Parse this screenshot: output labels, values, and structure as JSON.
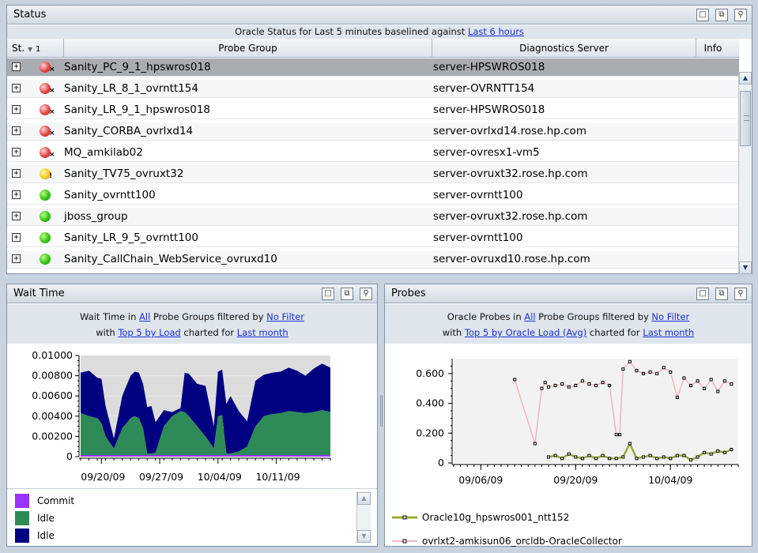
{
  "status_panel": {
    "title": "Status",
    "subtitle_prefix": "Oracle Status for Last 5 minutes baselined against ",
    "subtitle_link": "Last 6 hours",
    "columns": {
      "status": "St.",
      "sort_order": "1",
      "probe_group": "Probe Group",
      "server": "Diagnostics Server",
      "info": "Info"
    },
    "rows": [
      {
        "status": "red",
        "mark": "×",
        "probe_group": "Sanity_PC_9_1_hpswros018",
        "server": "server-HPSWROS018"
      },
      {
        "status": "red",
        "mark": "×",
        "probe_group": "Sanity_LR_8_1_ovrntt154",
        "server": "server-OVRNTT154"
      },
      {
        "status": "red",
        "mark": "×",
        "probe_group": "Sanity_LR_9_1_hpswros018",
        "server": "server-HPSWROS018"
      },
      {
        "status": "red",
        "mark": "×",
        "probe_group": "Sanity_CORBA_ovrlxd14",
        "server": "server-ovrlxd14.rose.hp.com"
      },
      {
        "status": "red",
        "mark": "×",
        "probe_group": "MQ_amkilab02",
        "server": "server-ovresx1-vm5"
      },
      {
        "status": "yellow",
        "mark": "!",
        "probe_group": "Sanity_TV75_ovruxt32",
        "server": "server-ovruxt32.rose.hp.com"
      },
      {
        "status": "green",
        "mark": "",
        "probe_group": "Sanity_ovrntt100",
        "server": "server-ovrntt100"
      },
      {
        "status": "green",
        "mark": "",
        "probe_group": "jboss_group",
        "server": "server-ovruxt32.rose.hp.com"
      },
      {
        "status": "green",
        "mark": "",
        "probe_group": "Sanity_LR_9_5_ovrntt100",
        "server": "server-ovrntt100"
      },
      {
        "status": "green",
        "mark": "",
        "probe_group": "Sanity_CallChain_WebService_ovruxd10",
        "server": "server-ovruxd10.rose.hp.com"
      }
    ]
  },
  "wait_panel": {
    "title": "Wait Time",
    "line1_prefix": "Wait Time in ",
    "line1_link1": "All",
    "line1_mid": " Probe Groups filtered by ",
    "line1_link2": "No Filter",
    "line2_prefix": "with ",
    "line2_link1": "Top 5 by Load",
    "line2_mid": " charted for ",
    "line2_link2": "Last month",
    "legend": [
      {
        "label": "Commit",
        "color": "#9a33ff"
      },
      {
        "label": "Idle",
        "color": "#2e8b57"
      },
      {
        "label": "Idle",
        "color": "#000080"
      }
    ]
  },
  "probes_panel": {
    "title": "Probes",
    "line1_prefix": "Oracle Probes in ",
    "line1_link1": "All",
    "line1_mid": " Probe Groups filtered by ",
    "line1_link2": "No Filter",
    "line2_prefix": "with ",
    "line2_link1": "Top 5 by Oracle Load (Avg)",
    "line2_mid": " charted for ",
    "line2_link2": "Last month"
  },
  "window_buttons": {
    "restore": "□",
    "popout": "⧉",
    "pin": "⚲"
  },
  "chart_data": [
    {
      "type": "area",
      "stacked": true,
      "x_tick_labels": [
        "09/20/09",
        "09/27/09",
        "10/04/09",
        "10/11/09"
      ],
      "y_ticks": [
        "0.01000",
        "0.00800",
        "0.00600",
        "0.00400",
        "0.00200",
        "0"
      ],
      "ylim": [
        0,
        0.01
      ],
      "x_range_days": [
        0,
        30
      ],
      "series": [
        {
          "name": "Commit",
          "color": "#9a33ff",
          "x": [
            0,
            30
          ],
          "values": [
            0.0,
            0.0
          ]
        },
        {
          "name": "Idle",
          "color": "#2e8b57",
          "x": [
            0,
            1,
            2,
            2.5,
            3,
            4,
            5,
            6,
            6.5,
            7,
            7.5,
            8,
            8.5,
            9,
            10,
            11,
            12,
            12.5,
            13,
            14,
            15,
            16,
            16.5,
            17,
            17.5,
            18,
            19,
            20,
            21,
            22,
            23,
            24,
            25,
            26,
            27,
            28,
            29,
            30
          ],
          "values": [
            0.0043,
            0.004,
            0.0038,
            0.0033,
            0.002,
            0.0008,
            0.0028,
            0.0038,
            0.004,
            0.0038,
            0.0028,
            0.0003,
            0.0003,
            0.0004,
            0.003,
            0.004,
            0.0045,
            0.0044,
            0.004,
            0.003,
            0.002,
            0.0008,
            0.004,
            0.0041,
            0.0003,
            0.0003,
            0.0005,
            0.001,
            0.003,
            0.004,
            0.0042,
            0.0043,
            0.0045,
            0.0044,
            0.0043,
            0.0044,
            0.0046,
            0.0044
          ]
        },
        {
          "name": "Idle",
          "color": "#000080",
          "x": [
            0,
            1,
            2,
            2.5,
            3,
            4,
            5,
            6,
            6.5,
            7,
            7.5,
            8,
            8.5,
            9,
            10,
            11,
            12,
            12.5,
            13,
            14,
            15,
            16,
            16.5,
            17,
            17.5,
            18,
            19,
            20,
            21,
            22,
            23,
            24,
            25,
            26,
            27,
            28,
            29,
            30
          ],
          "values": [
            0.004,
            0.0045,
            0.004,
            0.0044,
            0.003,
            0.001,
            0.0032,
            0.0042,
            0.0044,
            0.0045,
            0.0044,
            0.0046,
            0.0047,
            0.003,
            0.0016,
            0.0004,
            0.0003,
            0.0039,
            0.0042,
            0.0042,
            0.005,
            0.0022,
            0.0044,
            0.0045,
            0.0049,
            0.0057,
            0.004,
            0.0025,
            0.0045,
            0.0041,
            0.0041,
            0.0041,
            0.0043,
            0.0041,
            0.0037,
            0.0043,
            0.0046,
            0.0044
          ]
        }
      ]
    },
    {
      "type": "line",
      "x_tick_labels": [
        "09/06/09",
        "09/20/09",
        "10/04/09"
      ],
      "y_ticks": [
        "0.600",
        "0.400",
        "0.200",
        "0"
      ],
      "ylim": [
        0,
        0.7
      ],
      "x_range_days": [
        0,
        42
      ],
      "series": [
        {
          "name": "Oracle10g_hpswros001_ntt152",
          "color": "#9aa830",
          "marker_color": "#000000",
          "x": [
            14,
            15,
            16,
            17,
            18,
            19,
            20,
            21,
            22,
            23,
            24,
            25,
            26,
            27,
            28,
            29,
            30,
            31,
            32,
            33,
            34,
            35,
            36,
            37,
            38,
            39,
            40,
            41
          ],
          "values": [
            0.04,
            0.05,
            0.03,
            0.06,
            0.04,
            0.03,
            0.05,
            0.03,
            0.05,
            0.03,
            0.03,
            0.04,
            0.13,
            0.03,
            0.04,
            0.05,
            0.03,
            0.04,
            0.03,
            0.05,
            0.05,
            0.02,
            0.04,
            0.07,
            0.06,
            0.08,
            0.07,
            0.09
          ]
        },
        {
          "name": "ovrlxt2-amkisun06_orcldb-OracleCollector",
          "color": "#f0b6bc",
          "marker_color": "#000000",
          "x": [
            9,
            12,
            13,
            13.5,
            14,
            15,
            16,
            17,
            18,
            19,
            20,
            21,
            22,
            23,
            24,
            24.5,
            25,
            26,
            27,
            28,
            29,
            30,
            31,
            32,
            33,
            34,
            35,
            36,
            37,
            38,
            39,
            40,
            41
          ],
          "values": [
            0.56,
            0.13,
            0.5,
            0.54,
            0.51,
            0.52,
            0.53,
            0.51,
            0.52,
            0.55,
            0.53,
            0.52,
            0.54,
            0.52,
            0.19,
            0.19,
            0.63,
            0.68,
            0.62,
            0.6,
            0.61,
            0.6,
            0.64,
            0.61,
            0.44,
            0.57,
            0.52,
            0.55,
            0.5,
            0.56,
            0.48,
            0.55,
            0.53
          ]
        }
      ]
    }
  ]
}
